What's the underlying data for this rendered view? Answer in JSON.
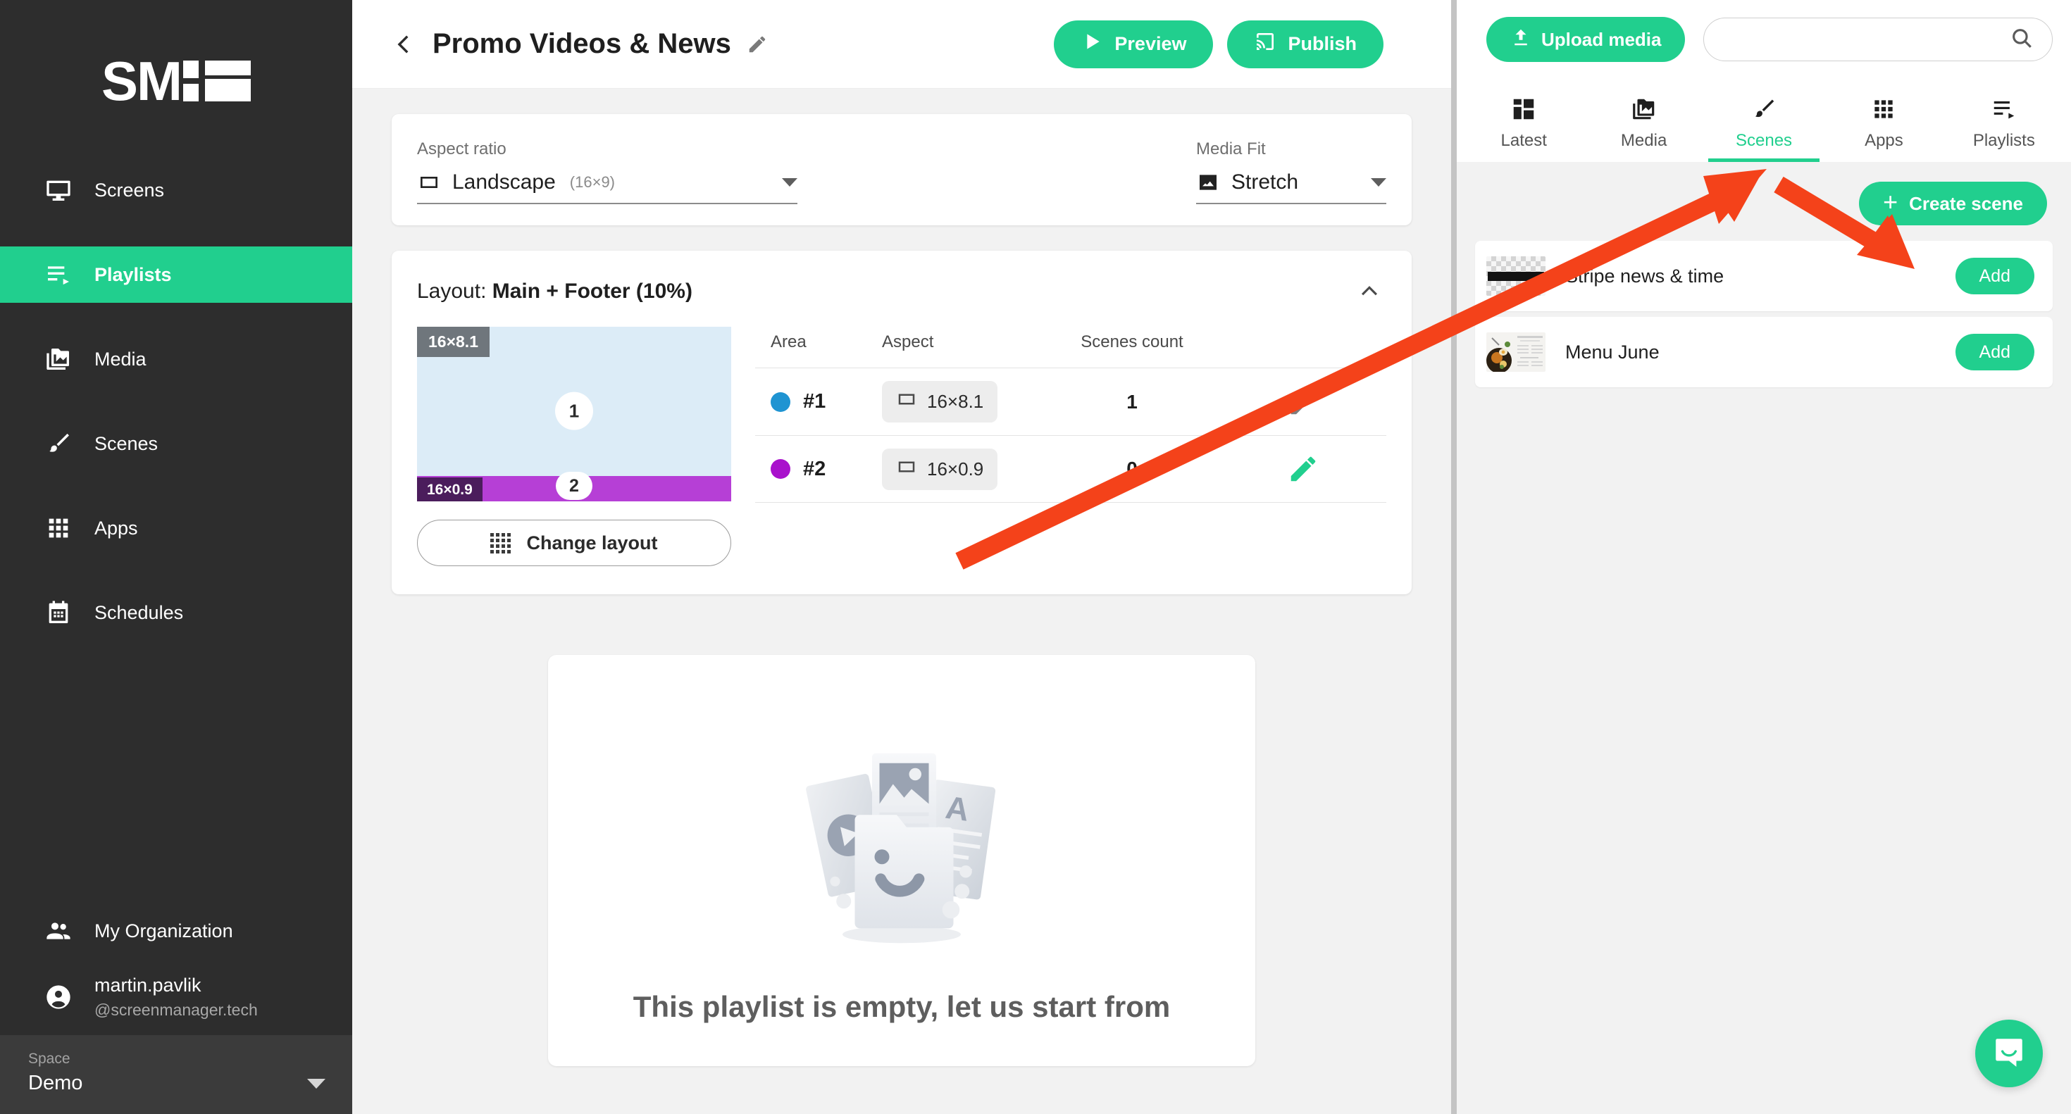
{
  "sidebar": {
    "logo_text": "SM",
    "items": [
      {
        "label": "Screens",
        "icon": "monitor-icon",
        "active": false
      },
      {
        "label": "Playlists",
        "icon": "playlist-icon",
        "active": true
      },
      {
        "label": "Media",
        "icon": "media-folder-icon",
        "active": false
      },
      {
        "label": "Scenes",
        "icon": "brush-icon",
        "active": false
      },
      {
        "label": "Apps",
        "icon": "apps-grid-icon",
        "active": false
      },
      {
        "label": "Schedules",
        "icon": "calendar-icon",
        "active": false
      }
    ],
    "organization_label": "My Organization",
    "user_name": "martin.pavlik",
    "user_handle": "@screenmanager.tech",
    "space_label": "Space",
    "space_value": "Demo"
  },
  "header": {
    "title": "Promo Videos & News",
    "preview_label": "Preview",
    "publish_label": "Publish"
  },
  "settings": {
    "aspect_ratio_label": "Aspect ratio",
    "aspect_ratio_value": "Landscape",
    "aspect_ratio_sub": "(16×9)",
    "media_fit_label": "Media Fit",
    "media_fit_value": "Stretch"
  },
  "layout": {
    "title_prefix": "Layout: ",
    "title_value": "Main + Footer (10%)",
    "preview_main_badge": "16×8.1",
    "preview_main_num": "1",
    "preview_footer_badge": "16×0.9",
    "preview_footer_num": "2",
    "change_layout_label": "Change layout",
    "table": {
      "headers": [
        "Area",
        "Aspect",
        "Scenes count"
      ],
      "rows": [
        {
          "area": "#1",
          "dot_color": "#1f94d2",
          "aspect": "16×8.1",
          "scenes_count": "1",
          "edit_color": "#7d7d7d"
        },
        {
          "area": "#2",
          "dot_color": "#a911cc",
          "aspect": "16×0.9",
          "scenes_count": "0",
          "edit_color": "#21cf8e"
        }
      ]
    }
  },
  "empty_state": {
    "message": "This playlist is empty, let us start from"
  },
  "right_panel": {
    "upload_label": "Upload media",
    "search_placeholder": "",
    "search_value": "",
    "tabs": [
      {
        "label": "Latest",
        "icon": "dashboard-icon",
        "active": false
      },
      {
        "label": "Media",
        "icon": "media-folder-icon",
        "active": false
      },
      {
        "label": "Scenes",
        "icon": "brush-icon",
        "active": true
      },
      {
        "label": "Apps",
        "icon": "apps-grid-icon",
        "active": false
      },
      {
        "label": "Playlists",
        "icon": "playlist-icon",
        "active": false
      }
    ],
    "create_scene_label": "Create scene",
    "scenes": [
      {
        "name": "Stripe news & time",
        "add_label": "Add",
        "thumb": "checker-strip"
      },
      {
        "name": "Menu June",
        "add_label": "Add",
        "thumb": "menu-photo"
      }
    ]
  },
  "colors": {
    "accent_green": "#21cf8e",
    "sidebar_bg": "#2d2d2d",
    "annotation_red": "#f4421a",
    "area1_blue": "#1f94d2",
    "area2_purple": "#a911cc"
  }
}
